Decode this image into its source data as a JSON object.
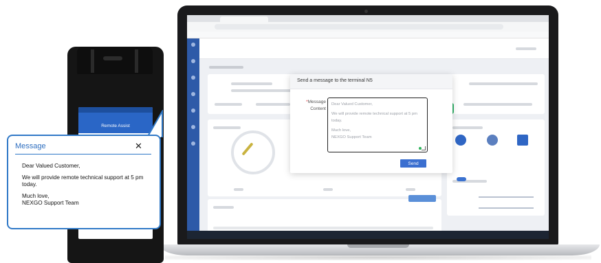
{
  "dialog": {
    "title": "Send a message to the terminal N5",
    "label_required": "*",
    "label": "Message\nContent",
    "message_lines": [
      "Dear Valued Customer,",
      "We will provide remote technical support at 5 pm today.",
      "Much love,",
      "NEXGO Support Team"
    ],
    "send_label": "Send"
  },
  "device": {
    "screen_title": "Remote Assist"
  },
  "callout": {
    "title": "Message",
    "close_icon": "close-icon",
    "body": {
      "greeting": "Dear Valued Customer,",
      "line1": "We will provide remote technical support at 5 pm today.",
      "signoff": "Much love,",
      "signature": "NEXGO Support Team"
    },
    "border_color": "#2f78c7"
  },
  "colors": {
    "accent": "#3b6fd0",
    "sidebar": "#2e5aa8"
  }
}
